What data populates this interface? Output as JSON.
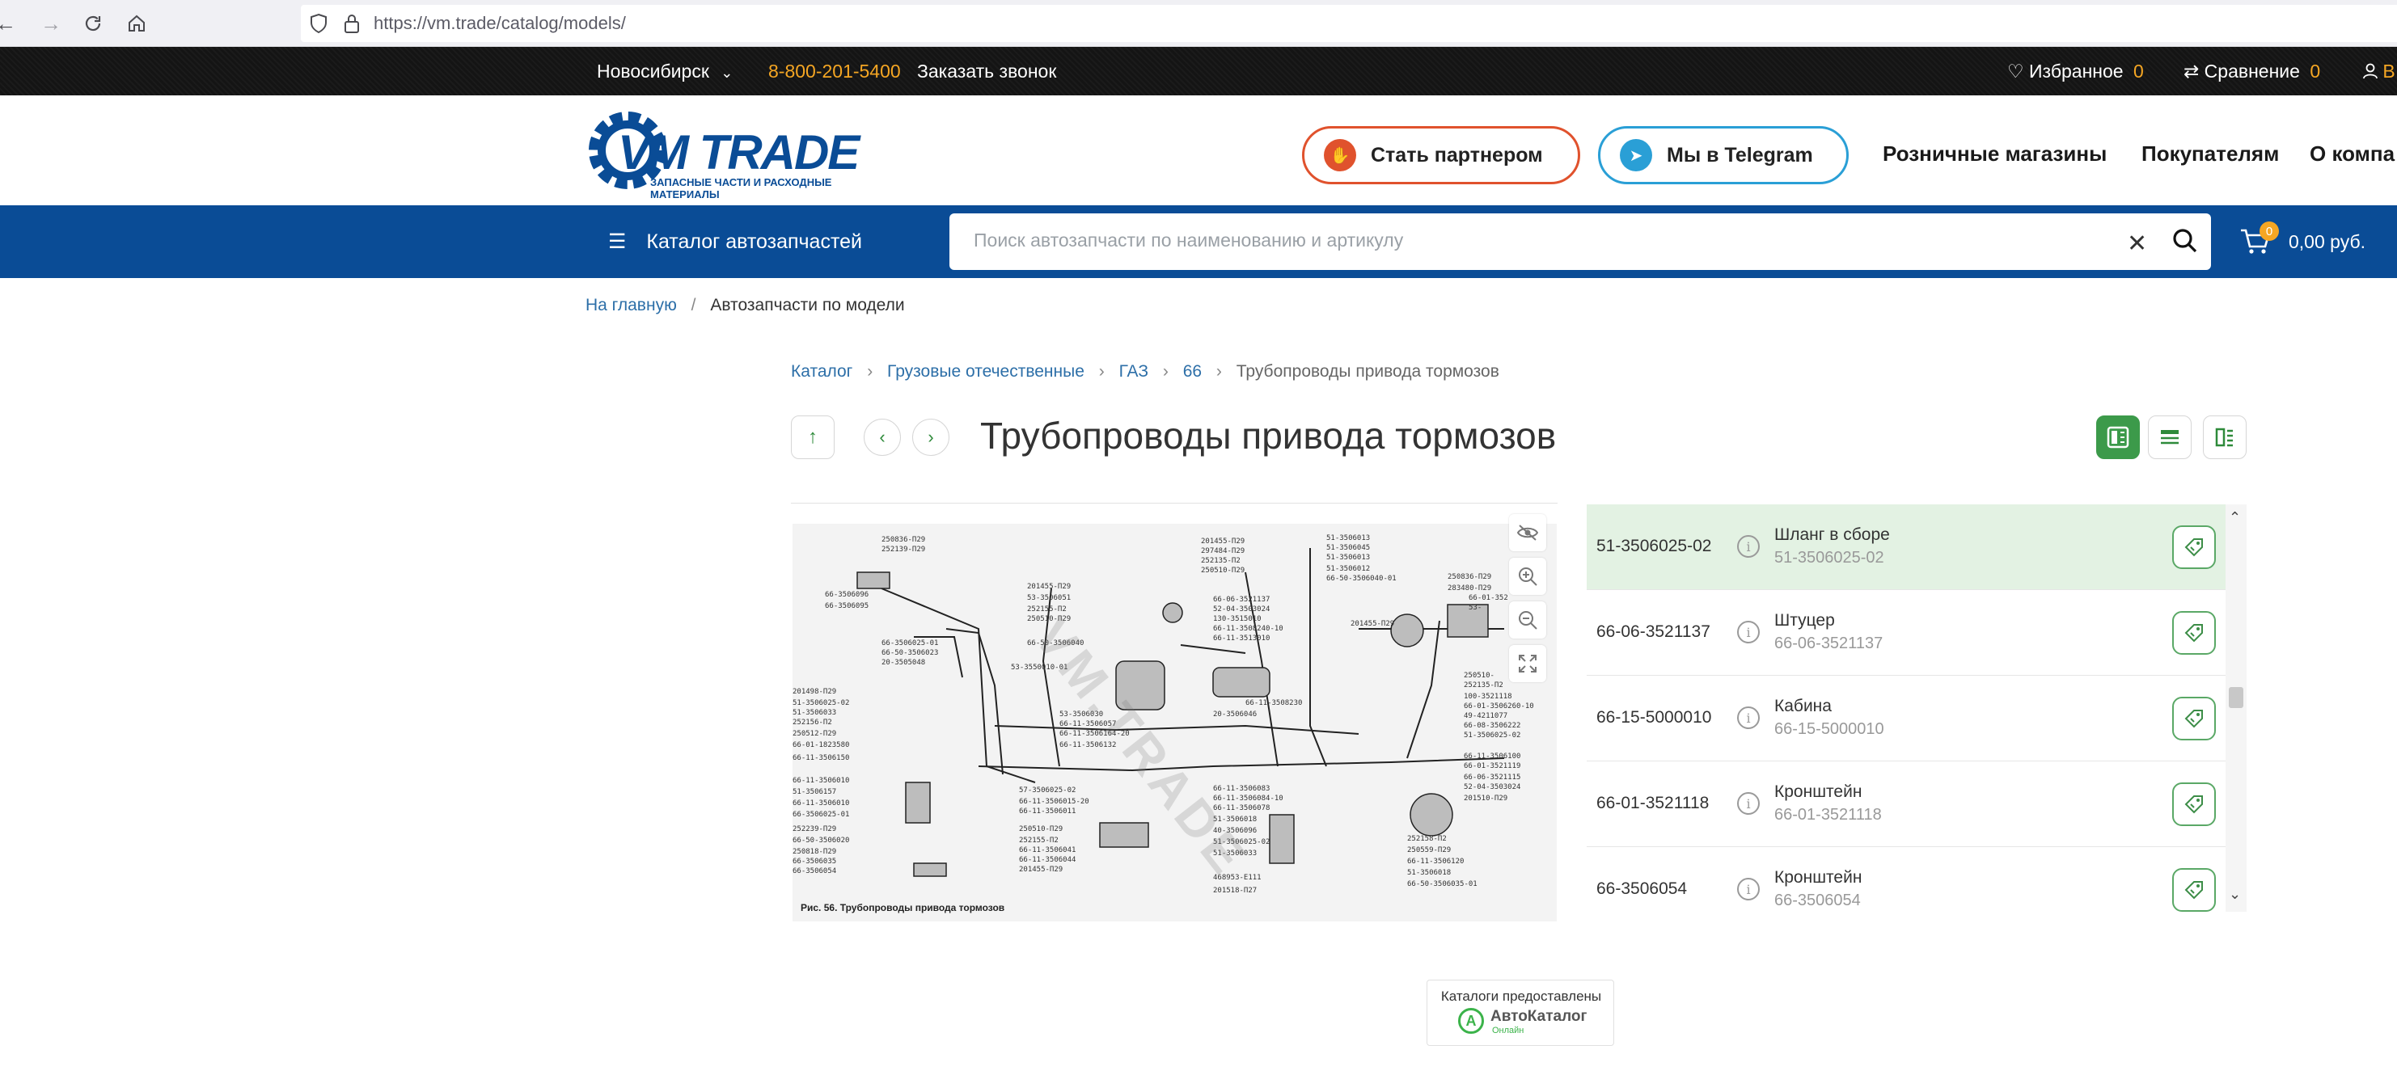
{
  "browser": {
    "url": "https://vm.trade/catalog/models/"
  },
  "topbar": {
    "city": "Новосибирск",
    "phone": "8-800-201-5400",
    "callback": "Заказать звонок",
    "favorites_label": "Избранное",
    "favorites_count": "0",
    "compare_label": "Сравнение",
    "compare_count": "0",
    "account_partial": "В"
  },
  "header": {
    "logo_text": "VM TRADE",
    "logo_tagline": "ЗАПАСНЫЕ ЧАСТИ И РАСХОДНЫЕ МАТЕРИАЛЫ",
    "partner_button": "Стать партнером",
    "telegram_button": "Мы в Telegram",
    "nav": [
      "Розничные магазины",
      "Покупателям",
      "О компа"
    ]
  },
  "bluebar": {
    "catalog_label": "Каталог автозапчастей",
    "search_placeholder": "Поиск автозапчасти по наименованию и артикулу",
    "cart_count": "0",
    "cart_total": "0,00 руб."
  },
  "breadcrumb_top": {
    "home": "На главную",
    "separator": "/",
    "current": "Автозапчасти по модели"
  },
  "breadcrumb_catalog": {
    "items": [
      "Каталог",
      "Грузовые отечественные",
      "ГАЗ",
      "66"
    ],
    "current": "Трубопроводы привода тормозов"
  },
  "page_title": "Трубопроводы привода тормозов",
  "diagram": {
    "caption": "Рис. 56. Трубопроводы привода тормозов",
    "watermark": "VM.TRADE"
  },
  "parts": [
    {
      "article": "51-3506025-02",
      "name": "Шланг в сборе",
      "code": "51-3506025-02",
      "selected": true
    },
    {
      "article": "66-06-3521137",
      "name": "Штуцер",
      "code": "66-06-3521137",
      "selected": false
    },
    {
      "article": "66-15-5000010",
      "name": "Кабина",
      "code": "66-15-5000010",
      "selected": false
    },
    {
      "article": "66-01-3521118",
      "name": "Кронштейн",
      "code": "66-01-3521118",
      "selected": false
    },
    {
      "article": "66-3506054",
      "name": "Кронштейн",
      "code": "66-3506054",
      "selected": false
    }
  ],
  "footer_badge": {
    "label": "Каталоги предоставлены",
    "brand": "АвтоКаталог",
    "sub": "Онлайн"
  },
  "colors": {
    "blue": "#0a4c96",
    "orange": "#f5a623",
    "green": "#2e8a3a",
    "selected_row": "#e3f2e3",
    "partner_border": "#e0522d",
    "telegram_border": "#2a9fd6"
  }
}
